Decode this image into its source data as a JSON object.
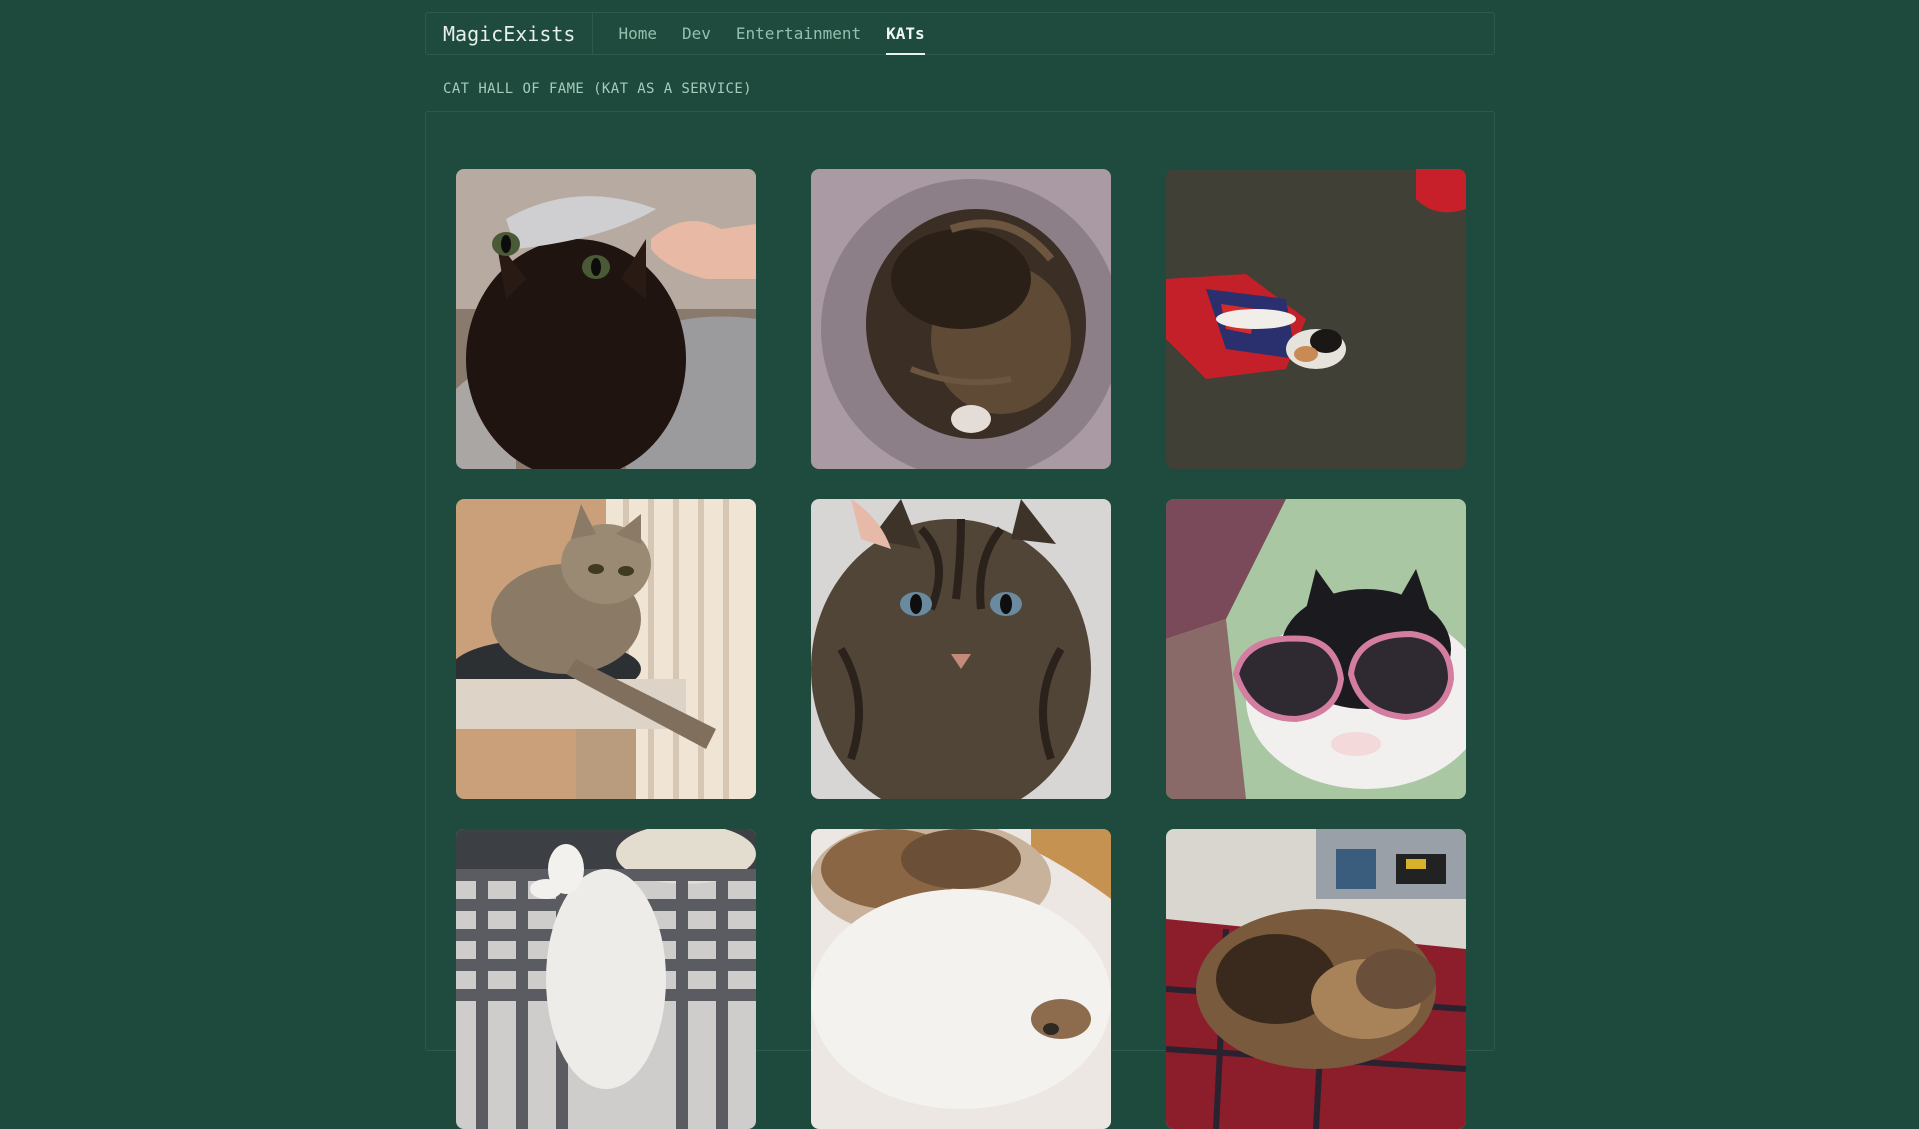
{
  "nav": {
    "brand": "MagicExists",
    "links": [
      "Home",
      "Dev",
      "Entertainment",
      "KATs"
    ],
    "active": "KATs"
  },
  "page": {
    "section_title": "CAT HALL OF FAME (KAT AS A SERVICE)"
  },
  "gallery": {
    "tiles": [
      {
        "subject": "black cat with foil hat"
      },
      {
        "subject": "tabby curled in blanket"
      },
      {
        "subject": "calico in superhero cape on carpet"
      },
      {
        "subject": "tabby lounging on cat tree"
      },
      {
        "subject": "tabby close-up being petted"
      },
      {
        "subject": "cat wearing pink sunglasses"
      },
      {
        "subject": "white cat on plaid bed"
      },
      {
        "subject": "fluffy calico belly"
      },
      {
        "subject": "calico sleeping on red blanket"
      }
    ]
  }
}
